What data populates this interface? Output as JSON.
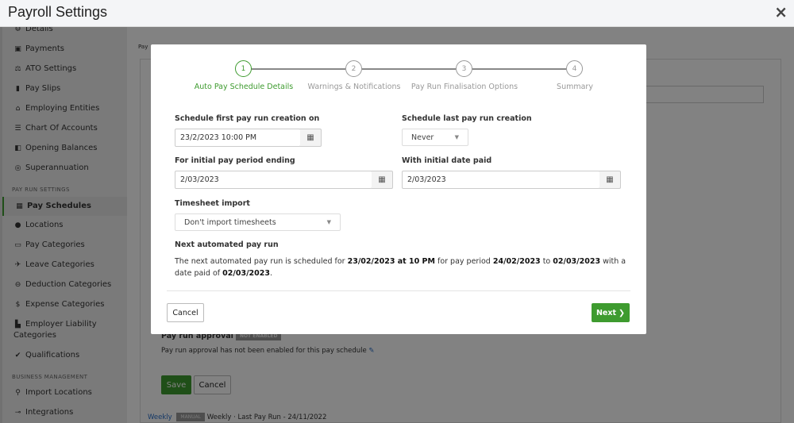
{
  "window": {
    "title": "Payroll Settings",
    "close_icon": "×"
  },
  "sidebar": {
    "items_top": [
      {
        "label": "Details",
        "icon": "⚙"
      },
      {
        "label": "Payments",
        "icon": "▣"
      },
      {
        "label": "ATO Settings",
        "icon": "⚖"
      },
      {
        "label": "Pay Slips",
        "icon": "▮"
      },
      {
        "label": "Employing Entities",
        "icon": "⌂"
      },
      {
        "label": "Chart Of Accounts",
        "icon": "☰"
      },
      {
        "label": "Opening Balances",
        "icon": "◧"
      },
      {
        "label": "Superannuation",
        "icon": "◎"
      }
    ],
    "section_pay_run": "PAY RUN SETTINGS",
    "items_pay_run": [
      {
        "label": "Pay Schedules",
        "icon": "▦",
        "active": true
      },
      {
        "label": "Locations",
        "icon": "●"
      },
      {
        "label": "Pay Categories",
        "icon": "▭"
      },
      {
        "label": "Leave Categories",
        "icon": "✈"
      },
      {
        "label": "Deduction Categories",
        "icon": "⊖"
      },
      {
        "label": "Expense Categories",
        "icon": "$"
      },
      {
        "label": "Employer Liability",
        "label2": "Categories",
        "icon": "▙"
      },
      {
        "label": "Qualifications",
        "icon": "✔"
      }
    ],
    "section_business": "BUSINESS MANAGEMENT",
    "items_business": [
      {
        "label": "Import Locations",
        "icon": "⚲"
      },
      {
        "label": "Integrations",
        "icon": "⊸"
      }
    ]
  },
  "background": {
    "breadcrumb_fragment": "Pay",
    "pay_run_approval_label": "Pay run approval",
    "pay_run_approval_badge": "NOT ENABLED",
    "pay_run_approval_text": "Pay run approval has not been enabled for this pay schedule",
    "save_label": "Save",
    "cancel_label": "Cancel",
    "list_row": {
      "name": "Weekly",
      "badge": "MANUAL",
      "frequency": "Weekly",
      "last_pay_run": "· Last Pay Run - 24/11/2022"
    }
  },
  "modal": {
    "steps": [
      {
        "number": "1",
        "label": "Auto Pay Schedule Details",
        "active": true
      },
      {
        "number": "2",
        "label": "Warnings & Notifications",
        "active": false
      },
      {
        "number": "3",
        "label": "Pay Run Finalisation Options",
        "active": false
      },
      {
        "number": "4",
        "label": "Summary",
        "active": false
      }
    ],
    "fields": {
      "first_creation_label": "Schedule first pay run creation on",
      "first_creation_value": "23/2/2023 10:00 PM",
      "last_creation_label": "Schedule last pay run creation",
      "last_creation_value": "Never",
      "period_ending_label": "For initial pay period ending",
      "period_ending_value": "2/03/2023",
      "date_paid_label": "With initial date paid",
      "date_paid_value": "2/03/2023",
      "timesheet_label": "Timesheet import",
      "timesheet_value": "Don't import timesheets"
    },
    "next_run": {
      "heading": "Next automated pay run",
      "text_1": "The next automated pay run is scheduled for ",
      "creation": "23/02/2023 at 10 PM",
      "text_2": " for pay period ",
      "period_start": "24/02/2023",
      "text_3": " to ",
      "period_end": "02/03/2023",
      "text_4": " with a date paid of ",
      "date_paid": "02/03/2023",
      "text_5": "."
    },
    "buttons": {
      "cancel": "Cancel",
      "next": "Next"
    }
  },
  "colors": {
    "accent": "#3e9b2f",
    "overlay": "rgba(0,0,0,0.49)"
  }
}
